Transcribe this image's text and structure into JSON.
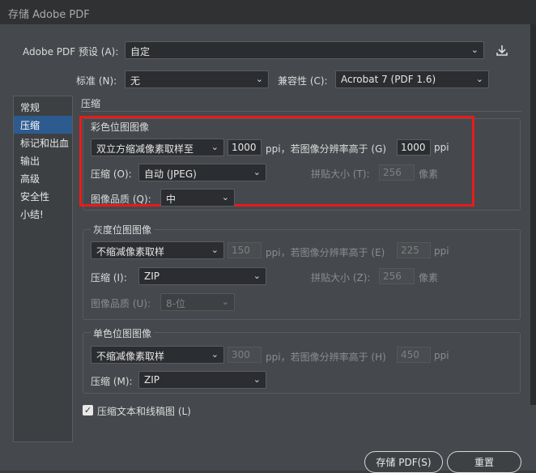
{
  "window": {
    "title": "存储 Adobe PDF"
  },
  "preset": {
    "label": "Adobe PDF 预设 (A):",
    "value": "自定"
  },
  "standard": {
    "label": "标准 (N):",
    "value": "无"
  },
  "compatibility": {
    "label": "兼容性 (C):",
    "value": "Acrobat 7 (PDF 1.6)"
  },
  "sidebar": {
    "items": [
      {
        "label": "常规"
      },
      {
        "label": "压缩"
      },
      {
        "label": "标记和出血"
      },
      {
        "label": "输出"
      },
      {
        "label": "高级"
      },
      {
        "label": "安全性"
      },
      {
        "label": "小结!"
      }
    ]
  },
  "main": {
    "heading": "压缩"
  },
  "color": {
    "title": "彩色位图图像",
    "sampling": "双立方缩减像素取样至",
    "ppi_value": "1000",
    "ppi_unit": "ppi，若图像分辨率高于 (G)",
    "above_value": "1000",
    "above_unit": "ppi",
    "compression_label": "压缩 (O):",
    "compression": "自动 (JPEG)",
    "tile_label": "拼贴大小 (T):",
    "tile_value": "256",
    "tile_unit": "像素",
    "quality_label": "图像品质 (Q):",
    "quality": "中"
  },
  "gray": {
    "title": "灰度位图图像",
    "sampling": "不缩减像素取样",
    "ppi_value": "150",
    "ppi_unit": "ppi，若图像分辨率高于 (E)",
    "above_value": "225",
    "above_unit": "ppi",
    "compression_label": "压缩 (I):",
    "compression": "ZIP",
    "tile_label": "拼贴大小 (Z):",
    "tile_value": "256",
    "tile_unit": "像素",
    "quality_label": "图像品质 (U):",
    "quality": "8-位"
  },
  "mono": {
    "title": "单色位图图像",
    "sampling": "不缩减像素取样",
    "ppi_value": "300",
    "ppi_unit": "ppi，若图像分辨率高于 (H)",
    "above_value": "450",
    "above_unit": "ppi",
    "compression_label": "压缩 (M):",
    "compression": "ZIP"
  },
  "compress_text": {
    "label": "压缩文本和线稿图 (L)",
    "checked": true
  },
  "buttons": {
    "save": "存储 PDF(S)",
    "reset": "重置"
  }
}
